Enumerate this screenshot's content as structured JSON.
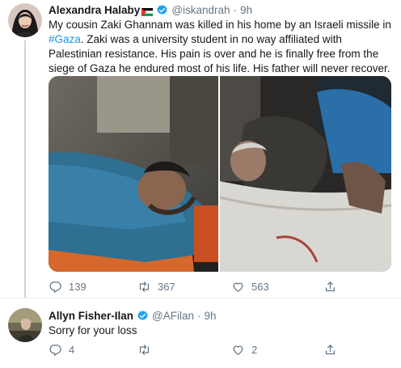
{
  "tweets": [
    {
      "author_name": "Alexandra Halaby",
      "handle": "@iskandrah",
      "separator": "·",
      "time": "9h",
      "text_parts": {
        "before_hashtag": "My cousin Zaki Ghannam was killed in his home by an Israeli missile in ",
        "hashtag": "#Gaza",
        "after_hashtag": ". Zaki was a university student in no way affiliated with Palestinian resistance. His pain is over and he is finally free from the siege of Gaza he endured most of his life. His father will never recover."
      },
      "replies": "139",
      "retweets": "367",
      "likes": "563",
      "media_count": 2
    },
    {
      "author_name": "Allyn Fisher-Ilan",
      "handle": "@AFilan",
      "separator": "·",
      "time": "9h",
      "text": "Sorry for your loss",
      "replies": "4",
      "retweets": "",
      "likes": "2"
    }
  ],
  "colors": {
    "accent": "#1b95e0",
    "verified": "#1da1f2",
    "muted": "#657786",
    "divider": "#e6ecf0"
  },
  "icons": [
    "verified-badge-icon",
    "palestine-flag-icon",
    "reply-icon",
    "retweet-icon",
    "like-icon",
    "share-icon"
  ]
}
